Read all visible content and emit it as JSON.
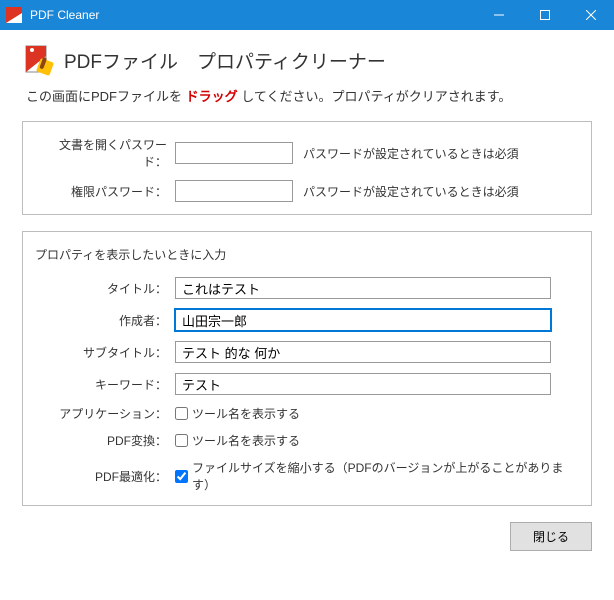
{
  "window": {
    "title": "PDF Cleaner"
  },
  "header": {
    "title": "PDFファイル　プロパティクリーナー"
  },
  "instruction": {
    "prefix": "この画面にPDFファイルを ",
    "drag": "ドラッグ",
    "suffix": " してください。プロパティがクリアされます。"
  },
  "passwords": {
    "open_label": "文書を開くパスワード：",
    "open_value": "",
    "open_hint": "パスワードが設定されているときは必須",
    "perm_label": "権限パスワード：",
    "perm_value": "",
    "perm_hint": "パスワードが設定されているときは必須"
  },
  "props": {
    "legend": "プロパティを表示したいときに入力",
    "title_label": "タイトル：",
    "title_value": "これはテスト",
    "author_label": "作成者：",
    "author_value": "山田宗一郎",
    "subtitle_label": "サブタイトル：",
    "subtitle_value": "テスト 的な 何か",
    "keywords_label": "キーワード：",
    "keywords_value": "テスト",
    "app_label": "アプリケーション：",
    "app_check": "ツール名を表示する",
    "conv_label": "PDF変換：",
    "conv_check": "ツール名を表示する",
    "opt_label": "PDF最適化：",
    "opt_check": "ファイルサイズを縮小する（PDFのバージョンが上がることがあります）"
  },
  "buttons": {
    "close": "閉じる"
  }
}
